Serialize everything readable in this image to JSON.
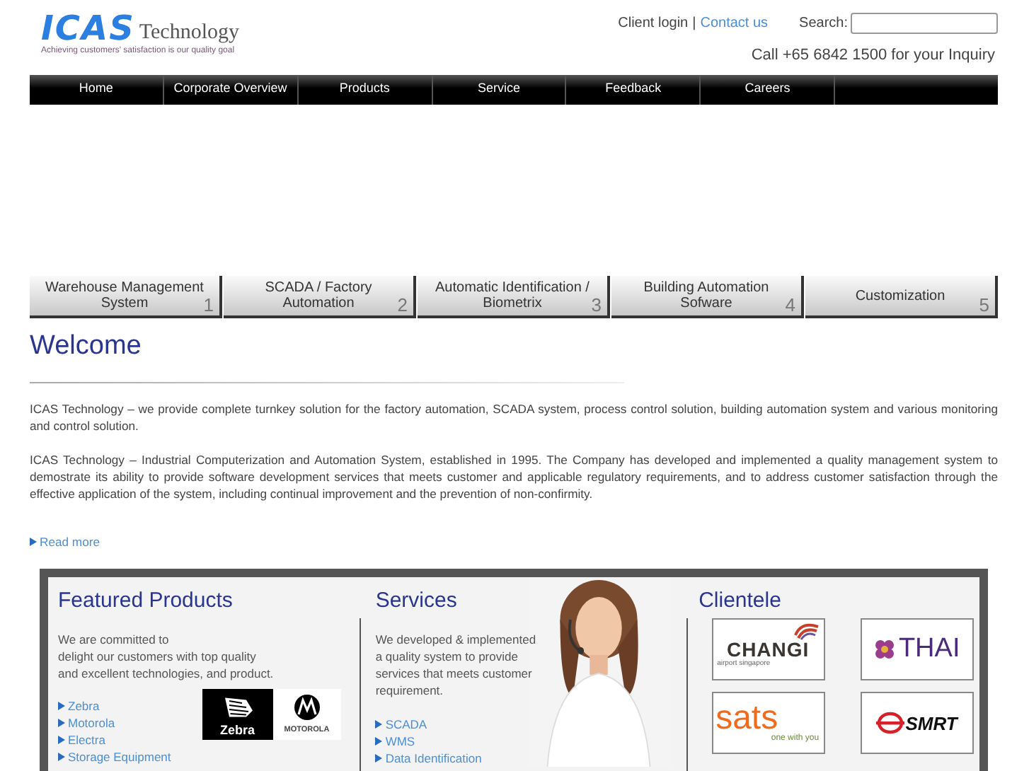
{
  "logo": {
    "brand": "ICAS",
    "suffix": "Technology",
    "tagline": "Achieving customers' satisfaction is our quality goal"
  },
  "top_links": {
    "login": "Client login",
    "separator": "|",
    "contact": "Contact us"
  },
  "search": {
    "label": "Search:"
  },
  "phone": "Call +65 6842 1500 for your Inquiry",
  "nav": [
    "Home",
    "Corporate Overview",
    "Products",
    "Service",
    "Feedback",
    "Careers"
  ],
  "tabs": [
    {
      "label": "Warehouse Management System",
      "number": "1"
    },
    {
      "label": "SCADA / Factory Automation",
      "number": "2"
    },
    {
      "label": "Automatic Identification / Biometrix",
      "number": "3"
    },
    {
      "label": "Building Automation Sofware",
      "number": "4"
    },
    {
      "label": "Customization",
      "number": "5"
    }
  ],
  "welcome": {
    "title": "Welcome",
    "paragraphs": [
      "ICAS Technology – we provide complete turnkey solution for the factory automation, SCADA system, process control solution, building automation system and various monitoring and control solution.",
      "ICAS Technology – Industrial Computerization and Automation System, established in 1995. The Company has developed and implemented a quality management system to demostrate its ability to provide software development services that meets customer and applicable regulatory requirements, and to address customer satisfaction through the effective application of the system, including continual improvement and the prevention of non-confirmity."
    ],
    "read_more": "Read more"
  },
  "featured": {
    "title": "Featured Products",
    "lines": [
      "We are committed to",
      "delight our customers with top quality",
      "and excellent technologies, and product."
    ],
    "links": [
      "Zebra",
      "Motorola",
      "Electra",
      "Storage Equipment"
    ],
    "brands": [
      "Zebra",
      "MOTOROLA"
    ]
  },
  "services": {
    "title": "Services",
    "lines": [
      "We developed & implemented",
      "a quality system to provide",
      "services that meets customer",
      "requirement."
    ],
    "links": [
      "SCADA",
      "WMS",
      "Data Identification"
    ],
    "photo": {
      "kind": "picture"
    }
  },
  "clientele": {
    "title": "Clientele",
    "clients": [
      {
        "kind": "changi",
        "name": "CHANGI",
        "tagline": "airport singapore"
      },
      {
        "kind": "thai",
        "name": "THAI"
      },
      {
        "kind": "sats",
        "name": "sats",
        "tagline": "one with you"
      },
      {
        "kind": "smrt",
        "name": "SMRT"
      }
    ]
  }
}
